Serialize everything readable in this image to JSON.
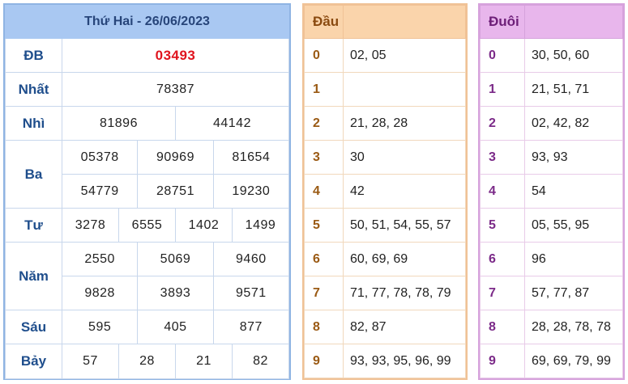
{
  "results": {
    "title": "Thứ Hai - 26/06/2023",
    "special": {
      "label": "ĐB",
      "values": [
        "03493"
      ]
    },
    "first": {
      "label": "Nhất",
      "values": [
        "78387"
      ]
    },
    "second": {
      "label": "Nhì",
      "values": [
        "81896",
        "44142"
      ]
    },
    "third": {
      "label": "Ba",
      "values": [
        "05378",
        "90969",
        "81654",
        "54779",
        "28751",
        "19230"
      ]
    },
    "fourth": {
      "label": "Tư",
      "values": [
        "3278",
        "6555",
        "1402",
        "1499"
      ]
    },
    "fifth": {
      "label": "Năm",
      "values": [
        "2550",
        "5069",
        "9460",
        "9828",
        "3893",
        "9571"
      ]
    },
    "sixth": {
      "label": "Sáu",
      "values": [
        "595",
        "405",
        "877"
      ]
    },
    "seventh": {
      "label": "Bảy",
      "values": [
        "57",
        "28",
        "21",
        "82"
      ]
    }
  },
  "head": {
    "header": "Đầu",
    "rows": [
      {
        "digit": "0",
        "values": "02, 05"
      },
      {
        "digit": "1",
        "values": ""
      },
      {
        "digit": "2",
        "values": "21, 28, 28"
      },
      {
        "digit": "3",
        "values": "30"
      },
      {
        "digit": "4",
        "values": "42"
      },
      {
        "digit": "5",
        "values": "50, 51, 54, 55, 57"
      },
      {
        "digit": "6",
        "values": "60, 69, 69"
      },
      {
        "digit": "7",
        "values": "71, 77, 78, 78, 79"
      },
      {
        "digit": "8",
        "values": "82, 87"
      },
      {
        "digit": "9",
        "values": "93, 93, 95, 96, 99"
      }
    ]
  },
  "tail": {
    "header": "Đuôi",
    "rows": [
      {
        "digit": "0",
        "values": "30, 50, 60"
      },
      {
        "digit": "1",
        "values": "21, 51, 71"
      },
      {
        "digit": "2",
        "values": "02, 42, 82"
      },
      {
        "digit": "3",
        "values": "93, 93"
      },
      {
        "digit": "4",
        "values": "54"
      },
      {
        "digit": "5",
        "values": "05, 55, 95"
      },
      {
        "digit": "6",
        "values": "96"
      },
      {
        "digit": "7",
        "values": "57, 77, 87"
      },
      {
        "digit": "8",
        "values": "28, 28, 78, 78"
      },
      {
        "digit": "9",
        "values": "69, 69, 79, 99"
      }
    ]
  },
  "colors": {
    "results_header": "#a9c8f2",
    "head_header": "#fad4ab",
    "tail_header": "#e8b6ec",
    "special_prize": "#e0141e"
  }
}
